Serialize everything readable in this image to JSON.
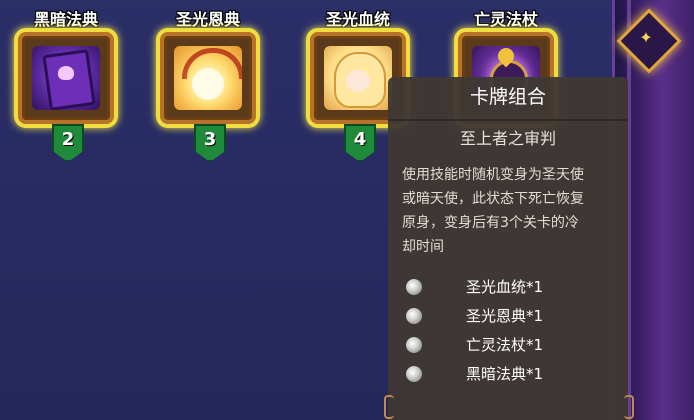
{
  "cards": [
    {
      "name": "黑暗法典",
      "level": "2",
      "art": "dark-tome"
    },
    {
      "name": "圣光恩典",
      "level": "3",
      "art": "holy-grace"
    },
    {
      "name": "圣光血统",
      "level": "4",
      "art": "holy-bloodline"
    },
    {
      "name": "亡灵法杖",
      "level": "",
      "art": "undead-staff"
    }
  ],
  "tooltip": {
    "title": "卡牌组合",
    "subtitle": "至上者之审判",
    "description": "使用技能时随机变身为圣天使或暗天使，此状态下死亡恢复原身，变身后有3个关卡的冷却时间",
    "requirements": [
      {
        "label": "圣光血统*1"
      },
      {
        "label": "圣光恩典*1"
      },
      {
        "label": "亡灵法杖*1"
      },
      {
        "label": "黑暗法典*1"
      }
    ]
  },
  "colors": {
    "background": "#25285a",
    "card_border": "#f0dd3e",
    "level_badge": "#1f8a3a",
    "tooltip_bg": "#403834",
    "side_panel": "#5a2f8a"
  }
}
